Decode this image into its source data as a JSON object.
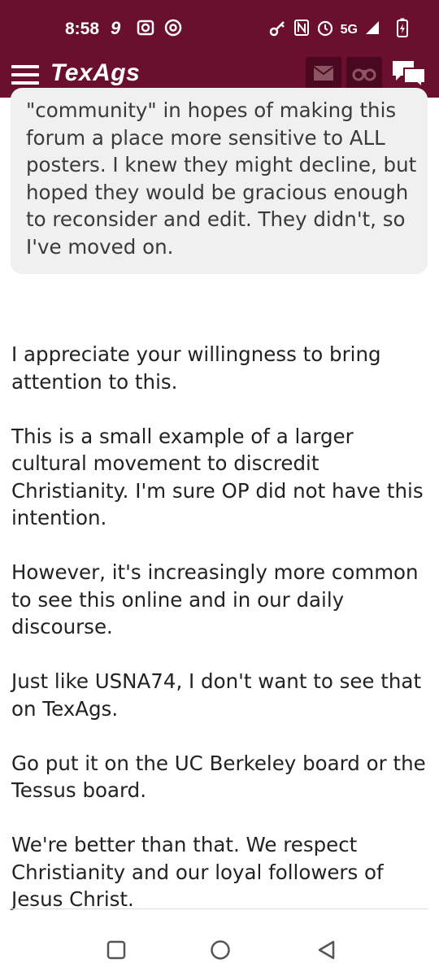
{
  "status_bar": {
    "time": "8:58",
    "network": "5G",
    "left_icons": [
      "nine-app-icon",
      "camera-scan-icon",
      "chrome-icon"
    ],
    "right_icons": [
      "key-icon",
      "nfc-icon",
      "alarm-icon",
      "signal-icon",
      "battery-charging-icon"
    ]
  },
  "app_bar": {
    "logo": "TexAgs",
    "icons": [
      "menu-icon",
      "mail-icon",
      "binoculars-icon",
      "chat-bubbles-icon"
    ],
    "brand_color": "#6b0f2e"
  },
  "quote": {
    "lines": [
      "\"community\" in hopes of making this",
      "forum a place more sensitive to ALL",
      "posters. I knew they might decline, but",
      "hoped they would be gracious enough",
      "to reconsider and edit. They didn't, so",
      "I've moved on."
    ]
  },
  "post": {
    "paragraphs": [
      "I appreciate your willingness to bring attention to this.",
      "This is a small example of a larger cultural movement to discredit Christianity. I'm sure OP did not have this intention.",
      "However, it's increasingly more common to see this online and in our daily discourse.",
      "Just like USNA74, I don't want to see that on TexAgs.",
      "Go put it on the UC Berkeley board or the Tessus board.",
      "We're better than that. We respect Christianity and our loyal followers of Jesus Christ."
    ]
  },
  "nav_bar": {
    "buttons": [
      "recents-icon",
      "home-icon",
      "back-icon"
    ]
  }
}
